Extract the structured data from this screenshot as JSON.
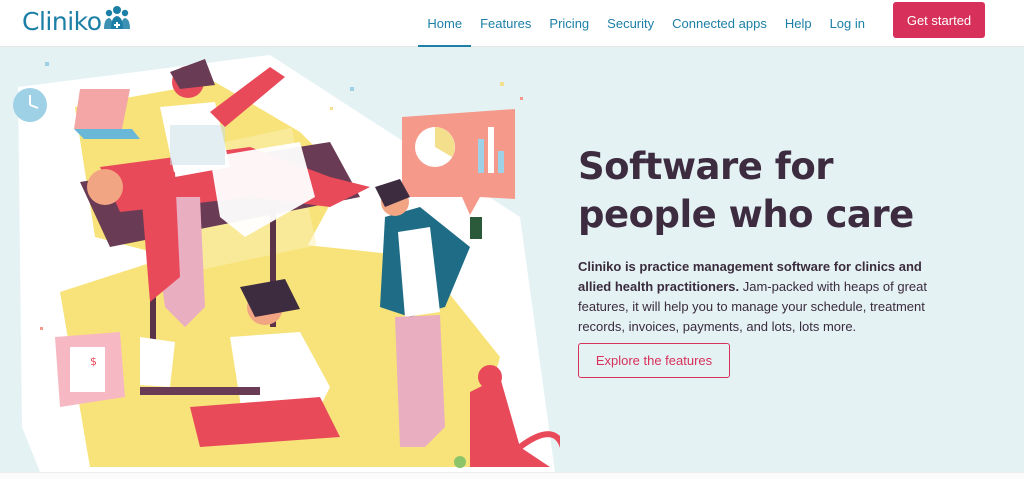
{
  "header": {
    "logo_text": "Cliniko",
    "logo_icon": "cliniko-people-icon",
    "nav": [
      {
        "label": "Home",
        "active": true
      },
      {
        "label": "Features"
      },
      {
        "label": "Pricing"
      },
      {
        "label": "Security"
      },
      {
        "label": "Connected apps"
      },
      {
        "label": "Help"
      },
      {
        "label": "Log in"
      }
    ],
    "cta_label": "Get started"
  },
  "hero": {
    "headline_line1": "Software for",
    "headline_line2": "people who care",
    "description_bold": "Cliniko is practice management software for clinics and allied health practitioners.",
    "description_rest": " Jam-packed with heaps of great features, it will help you to manage your schedule, treatment records, invoices, payments, and lots, lots more.",
    "button_label": "Explore the features"
  },
  "colors": {
    "brand_blue": "#1b7fa6",
    "accent_pink": "#d7305a",
    "hero_bg": "#e4f2f4",
    "headline": "#3d2b3f"
  }
}
